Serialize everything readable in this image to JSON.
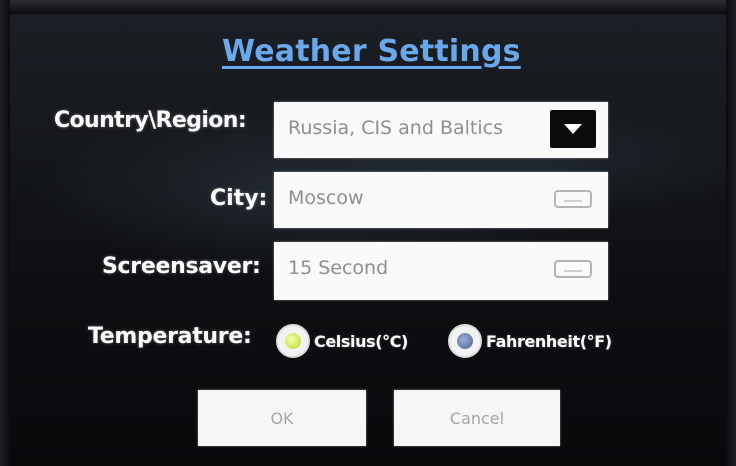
{
  "title": "Weather Settings",
  "form": {
    "country": {
      "label": "Country\\Region:",
      "value": "Russia, CIS and Baltics",
      "dropdown_icon": "chevron-down-icon"
    },
    "city": {
      "label": "City:",
      "value": "Moscow",
      "input_icon": "keyboard-icon"
    },
    "screensaver": {
      "label": "Screensaver:",
      "value": "15 Second",
      "input_icon": "keyboard-icon"
    },
    "temperature": {
      "label": "Temperature:",
      "options": [
        {
          "label": "Celsius(°C)",
          "selected": true
        },
        {
          "label": "Fahrenheit(°F)",
          "selected": false
        }
      ]
    }
  },
  "buttons": {
    "ok_label": "OK",
    "cancel_label": "Cancel"
  },
  "colors": {
    "title": "#6aa8ec",
    "background": "#0d0f12",
    "field_background": "#fafafa",
    "field_text": "#8f8f8f",
    "radio_selected": "#c8e34a",
    "radio_unselected": "#5f78a6"
  }
}
